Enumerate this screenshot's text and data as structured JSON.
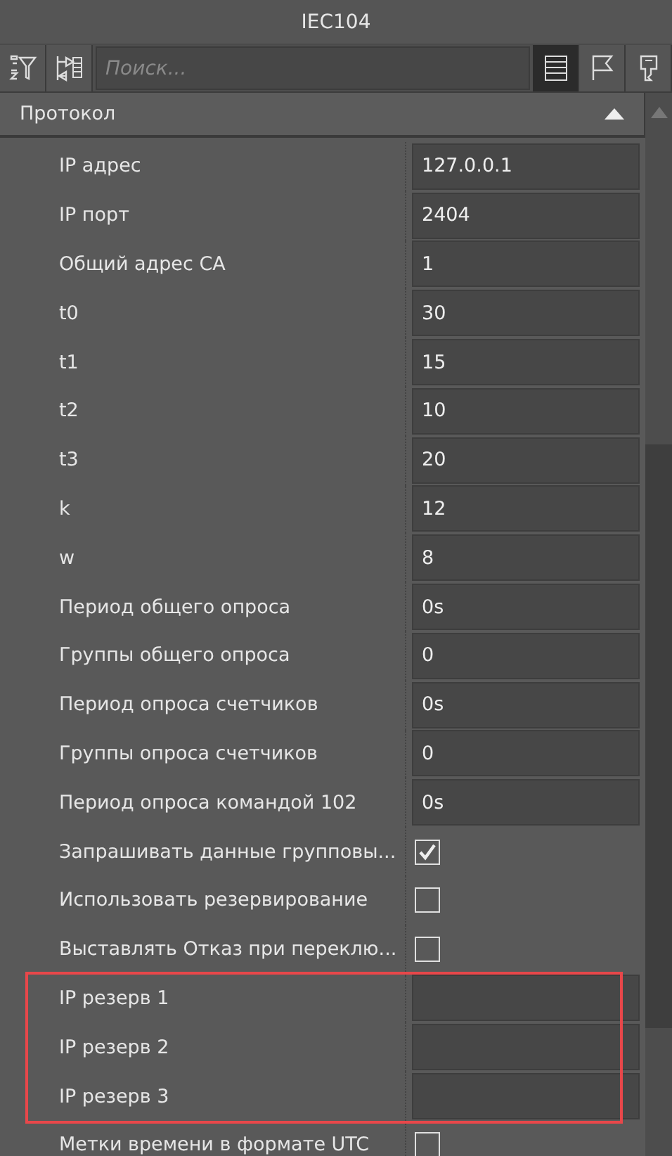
{
  "window": {
    "title": "IEC104"
  },
  "toolbar": {
    "left_buttons": [
      {
        "kind": "sort-filter",
        "selected": false
      },
      {
        "kind": "tree",
        "selected": false
      }
    ],
    "search": {
      "placeholder": "Поиск..."
    },
    "right_buttons": [
      {
        "kind": "list",
        "selected": true
      },
      {
        "kind": "flag",
        "selected": false
      },
      {
        "kind": "key",
        "selected": false
      }
    ]
  },
  "section": {
    "title": "Протокол",
    "expanded": true
  },
  "rows": [
    {
      "label": "IP адрес",
      "kind": "text",
      "value": "127.0.0.1",
      "highlighted": false
    },
    {
      "label": "IP порт",
      "kind": "text",
      "value": "2404",
      "highlighted": false
    },
    {
      "label": "Общий адрес СА",
      "kind": "text",
      "value": "1",
      "highlighted": false
    },
    {
      "label": "t0",
      "kind": "text",
      "value": "30",
      "highlighted": false
    },
    {
      "label": "t1",
      "kind": "text",
      "value": "15",
      "highlighted": false
    },
    {
      "label": "t2",
      "kind": "text",
      "value": "10",
      "highlighted": false
    },
    {
      "label": "t3",
      "kind": "text",
      "value": "20",
      "highlighted": false
    },
    {
      "label": "k",
      "kind": "text",
      "value": "12",
      "highlighted": false
    },
    {
      "label": "w",
      "kind": "text",
      "value": "8",
      "highlighted": false
    },
    {
      "label": "Период общего опроса",
      "kind": "text",
      "value": "0s",
      "highlighted": false
    },
    {
      "label": "Группы общего опроса",
      "kind": "text",
      "value": "0",
      "highlighted": false
    },
    {
      "label": "Период опроса счетчиков",
      "kind": "text",
      "value": "0s",
      "highlighted": false
    },
    {
      "label": "Группы опроса счетчиков",
      "kind": "text",
      "value": "0",
      "highlighted": false
    },
    {
      "label": "Период опроса командой 102",
      "kind": "text",
      "value": "0s",
      "highlighted": false
    },
    {
      "label": "Запрашивать данные групповы...",
      "kind": "checkbox",
      "checked": true,
      "highlighted": false
    },
    {
      "label": "Использовать резервирование",
      "kind": "checkbox",
      "checked": false,
      "highlighted": false
    },
    {
      "label": "Выставлять Отказ при переклю...",
      "kind": "checkbox",
      "checked": false,
      "highlighted": false
    },
    {
      "label": "IP резерв 1",
      "kind": "text",
      "value": "",
      "highlighted": true
    },
    {
      "label": "IP резерв 2",
      "kind": "text",
      "value": "",
      "highlighted": true
    },
    {
      "label": "IP резерв 3",
      "kind": "text",
      "value": "",
      "highlighted": true
    },
    {
      "label": "Метки времени в формате UTC",
      "kind": "checkbox",
      "checked": false,
      "highlighted": false
    }
  ]
}
